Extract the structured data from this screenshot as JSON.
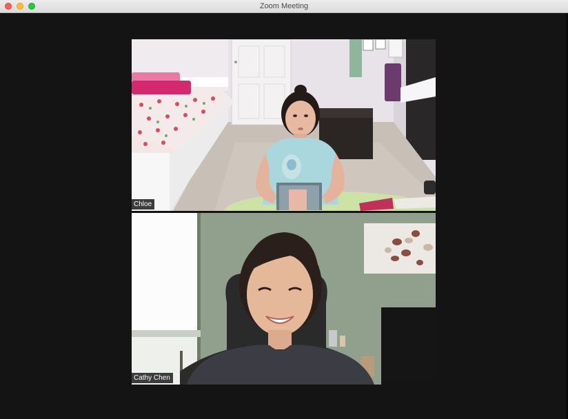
{
  "window": {
    "title": "Zoom Meeting"
  },
  "participants": [
    {
      "name": "Chloe"
    },
    {
      "name": "Cathy Chen"
    }
  ],
  "colors": {
    "background": "#141414",
    "label_background": "#141414",
    "label_text": "#ffffff"
  }
}
